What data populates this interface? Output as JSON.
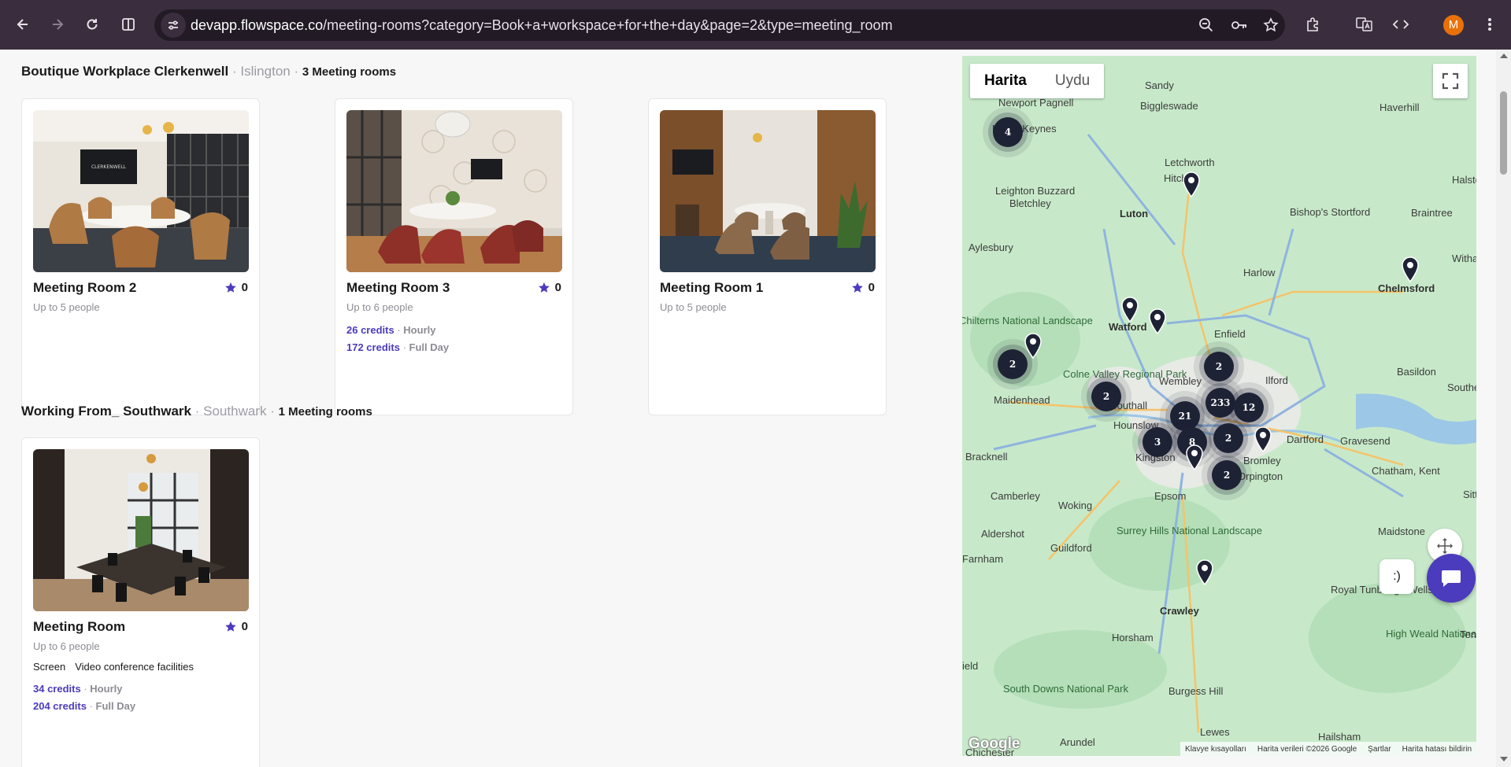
{
  "browser": {
    "url_host": "devapp.flowspace.co",
    "url_path": "/meeting-rooms?category=Book+a+workspace+for+the+day&page=2&type=meeting_room",
    "avatar_letter": "M",
    "icons": [
      "back-icon",
      "forward-icon",
      "reload-icon",
      "split-view-icon",
      "site-info-icon",
      "zoom-out-icon",
      "password-key-icon",
      "bookmark-star-icon",
      "extensions-icon",
      "translate-icon",
      "devtools-code-icon",
      "menu-kebab-icon"
    ]
  },
  "groups": [
    {
      "name": "Boutique Workplace Clerkenwell",
      "sep": "·",
      "area": "Islington",
      "count": "3 Meeting rooms",
      "rooms": [
        {
          "title": "Meeting Room 2",
          "rating": "0",
          "capacity": "Up to 5 people"
        },
        {
          "title": "Meeting Room 3",
          "rating": "0",
          "capacity": "Up to 6 people",
          "prices": [
            {
              "credits": "26 credits",
              "period": "Hourly"
            },
            {
              "credits": "172 credits",
              "period": "Full Day"
            }
          ]
        },
        {
          "title": "Meeting Room 1",
          "rating": "0",
          "capacity": "Up to 5 people"
        }
      ]
    },
    {
      "name": "Working From_ Southwark",
      "sep": "·",
      "area": "Southwark",
      "count": "1 Meeting rooms",
      "rooms": [
        {
          "title": "Meeting Room",
          "rating": "0",
          "capacity": "Up to 6 people",
          "amenities": [
            "Screen",
            "Video conference facilities"
          ],
          "prices": [
            {
              "credits": "34 credits",
              "period": "Hourly"
            },
            {
              "credits": "204 credits",
              "period": "Full Day"
            }
          ]
        }
      ]
    }
  ],
  "price_sep": "·",
  "map": {
    "tabs": {
      "map": "Harita",
      "satellite": "Uydu"
    },
    "clusters": [
      "4",
      "2",
      "2",
      "2",
      "233",
      "12",
      "21",
      "3",
      "8",
      "2",
      "2"
    ],
    "labels": {
      "newport_pagnell": "Newport Pagnell",
      "milton_keynes": "Milton Keynes",
      "bletchley": "Bletchley",
      "sandy": "Sandy",
      "biggleswade": "Biggleswade",
      "haverhill": "Haverhill",
      "letchworth": "Letchworth",
      "hitchin": "Hitchin",
      "leighton_buzzard": "Leighton Buzzard",
      "luton": "Luton",
      "bishops_stortford": "Bishop's Stortford",
      "braintree": "Braintree",
      "halstead": "Halste",
      "aylesbury": "Aylesbury",
      "harlow": "Harlow",
      "chelmsford": "Chelmsford",
      "witham": "Witham",
      "chilterns": "Chilterns National Landscape",
      "watford": "Watford",
      "enfield": "Enfield",
      "colne_valley": "Colne Valley Regional Park",
      "maidenhead": "Maidenhead",
      "wembley": "Wembley",
      "ilford": "Ilford",
      "basildon": "Basildon",
      "southend": "Southe",
      "southall": "Southall",
      "hounslow": "Hounslow",
      "bracknell": "Bracknell",
      "kingston": "Kingston",
      "dartford": "Dartford",
      "gravesend": "Gravesend",
      "bromley": "Bromley",
      "orpington": "Orpington",
      "chatham": "Chatham, Kent",
      "camberley": "Camberley",
      "woking": "Woking",
      "epsom": "Epsom",
      "sittingbourne": "Sitt",
      "surrey_hills": "Surrey Hills National Landscape",
      "aldershot": "Aldershot",
      "guildford": "Guildford",
      "maidstone": "Maidstone",
      "farnham": "Farnham",
      "crawley": "Crawley",
      "royal_tunbridge": "Royal Tunbridge Wells",
      "high_weald": "High Weald National Landscape",
      "horsham": "Horsham",
      "burgess_hill": "Burgess Hill",
      "south_downs": "South Downs National Park",
      "arundel": "Arundel",
      "lewes": "Lewes",
      "hailsham": "Hailsham",
      "tenterden": "Tent",
      "field": "ield",
      "chichester": "Chichester"
    },
    "google": "Google",
    "attribution": {
      "shortcuts": "Klavye kısayolları",
      "data": "Harita verileri ©2026 Google",
      "terms": "Şartlar",
      "report": "Harita hatası bildirin"
    },
    "widget_smiley": ":)"
  },
  "colors": {
    "accent": "#4b3bbd",
    "chrome": "#3a2e3e",
    "cluster": "#1e2235"
  }
}
